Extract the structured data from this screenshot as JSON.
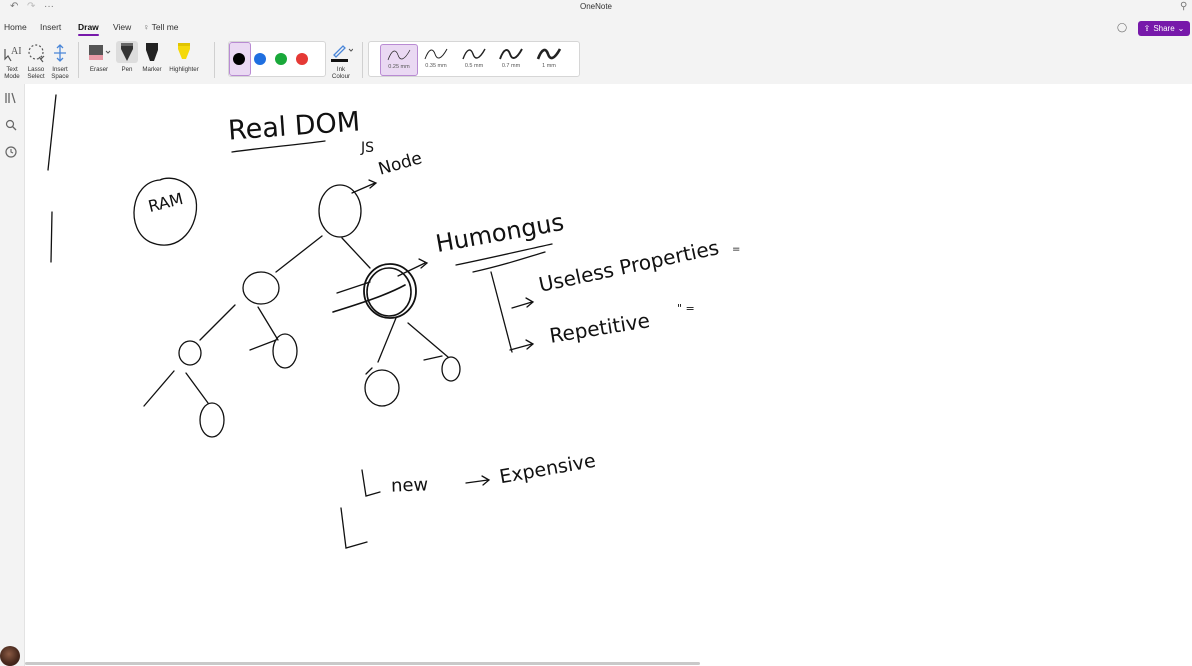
{
  "window": {
    "title": "OneNote",
    "undo_icon": "undo-icon",
    "redo_icon": "redo-icon",
    "more_label": "···"
  },
  "menu": {
    "tabs": [
      {
        "label": "Home"
      },
      {
        "label": "Insert"
      },
      {
        "label": "Draw",
        "active": true
      },
      {
        "label": "View"
      }
    ],
    "tell_me": "Tell me",
    "share_label": "Share",
    "share_chevron": "⌄"
  },
  "ribbon": {
    "text_mode": {
      "line1": "Text",
      "line2": "Mode"
    },
    "lasso_select": {
      "line1": "Lasso",
      "line2": "Select"
    },
    "insert_space": {
      "line1": "Insert",
      "line2": "Space"
    },
    "eraser": "Eraser",
    "pen": "Pen",
    "marker": "Marker",
    "highlighter": "Highlighter",
    "colors": [
      {
        "name": "black",
        "hex": "#000000",
        "selected": true
      },
      {
        "name": "blue",
        "hex": "#1f6fe0"
      },
      {
        "name": "green",
        "hex": "#19a83a"
      },
      {
        "name": "red",
        "hex": "#e53935"
      }
    ],
    "ink_colour": {
      "line1": "Ink",
      "line2": "Colour"
    },
    "thicknesses": [
      {
        "label": "0.25 mm",
        "selected": true
      },
      {
        "label": "0.35 mm"
      },
      {
        "label": "0.5 mm"
      },
      {
        "label": "0.7 mm"
      },
      {
        "label": "1 mm"
      }
    ]
  },
  "sidebar": {
    "icons": [
      "notebooks-icon",
      "search-icon",
      "recent-icon"
    ]
  },
  "notes": {
    "real_dom": "Real DOM",
    "js": "JS",
    "node": "Node",
    "ram": "RAM",
    "humongus": "Humongus",
    "useless": "Useless Properties",
    "repetitive": "Repetitive",
    "ditto": "\" =",
    "new": "new",
    "expensive": "Expensive",
    "eq": "="
  },
  "accent": "#7719aa"
}
